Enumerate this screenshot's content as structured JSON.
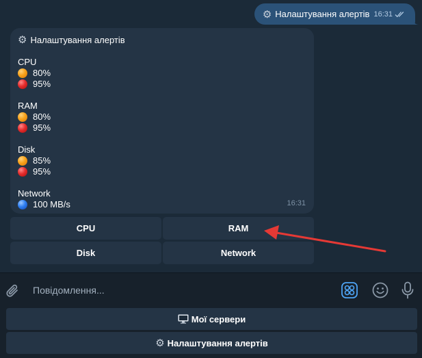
{
  "outgoing_message": {
    "text": "Налаштування алертів",
    "time": "16:31",
    "icon": "gear-icon",
    "status_icon": "double-check-icon"
  },
  "bot_message": {
    "title": "Налаштування алертів",
    "icon": "gear-icon",
    "time": "16:31",
    "sections": [
      {
        "name": "CPU",
        "thresholds": [
          {
            "level": "warning",
            "color": "orange",
            "value": "80%"
          },
          {
            "level": "critical",
            "color": "red",
            "value": "95%"
          }
        ]
      },
      {
        "name": "RAM",
        "thresholds": [
          {
            "level": "warning",
            "color": "orange",
            "value": "80%"
          },
          {
            "level": "critical",
            "color": "red",
            "value": "95%"
          }
        ]
      },
      {
        "name": "Disk",
        "thresholds": [
          {
            "level": "warning",
            "color": "orange",
            "value": "85%"
          },
          {
            "level": "critical",
            "color": "red",
            "value": "95%"
          }
        ]
      },
      {
        "name": "Network",
        "thresholds": [
          {
            "level": "info",
            "color": "blue",
            "value": "100 MB/s"
          }
        ]
      }
    ]
  },
  "inline_keyboard": {
    "cpu": "CPU",
    "ram": "RAM",
    "disk": "Disk",
    "network": "Network"
  },
  "composer": {
    "placeholder": "Повідомлення..."
  },
  "reply_keyboard": {
    "servers": "Мої сервери",
    "servers_icon": "desktop-computer-icon",
    "alerts": "Налаштування алертів",
    "alerts_icon": "gear-icon"
  },
  "colors": {
    "background": "#1b2a38",
    "bubble_out": "#2b5278",
    "bubble_in": "#243445",
    "panel": "#17212b",
    "accent": "#4ea4f5",
    "annotation": "#e53935"
  }
}
